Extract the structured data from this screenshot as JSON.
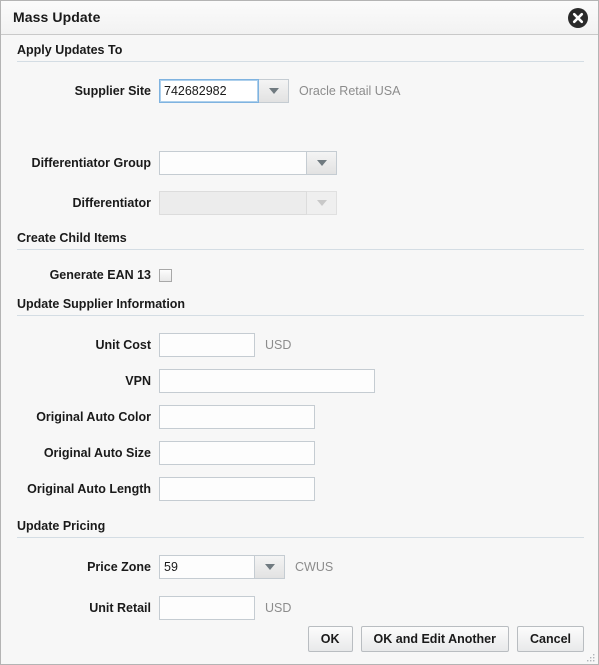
{
  "dialog": {
    "title": "Mass Update",
    "close_icon": "close-circle-icon"
  },
  "sections": {
    "apply_updates": {
      "title": "Apply Updates To"
    },
    "create_child": {
      "title": "Create Child Items"
    },
    "update_supplier": {
      "title": "Update Supplier Information"
    },
    "update_pricing": {
      "title": "Update Pricing"
    }
  },
  "fields": {
    "supplier_site": {
      "label": "Supplier Site",
      "value": "742682982",
      "suffix": "Oracle Retail USA",
      "dropdown_icon": "chevron-down-icon"
    },
    "differentiator_group": {
      "label": "Differentiator Group",
      "value": "",
      "dropdown_icon": "chevron-down-icon"
    },
    "differentiator": {
      "label": "Differentiator",
      "value": "",
      "dropdown_icon": "chevron-down-icon"
    },
    "generate_ean13": {
      "label": "Generate EAN 13",
      "checked": false
    },
    "unit_cost": {
      "label": "Unit Cost",
      "value": "",
      "suffix": "USD"
    },
    "vpn": {
      "label": "VPN",
      "value": ""
    },
    "original_auto_color": {
      "label": "Original Auto Color",
      "value": ""
    },
    "original_auto_size": {
      "label": "Original Auto Size",
      "value": ""
    },
    "original_auto_length": {
      "label": "Original Auto Length",
      "value": ""
    },
    "price_zone": {
      "label": "Price Zone",
      "value": "59",
      "suffix": "CWUS",
      "dropdown_icon": "chevron-down-icon"
    },
    "unit_retail": {
      "label": "Unit Retail",
      "value": "",
      "suffix": "USD"
    }
  },
  "footer": {
    "ok": "OK",
    "ok_edit_another": "OK and Edit Another",
    "cancel": "Cancel"
  }
}
